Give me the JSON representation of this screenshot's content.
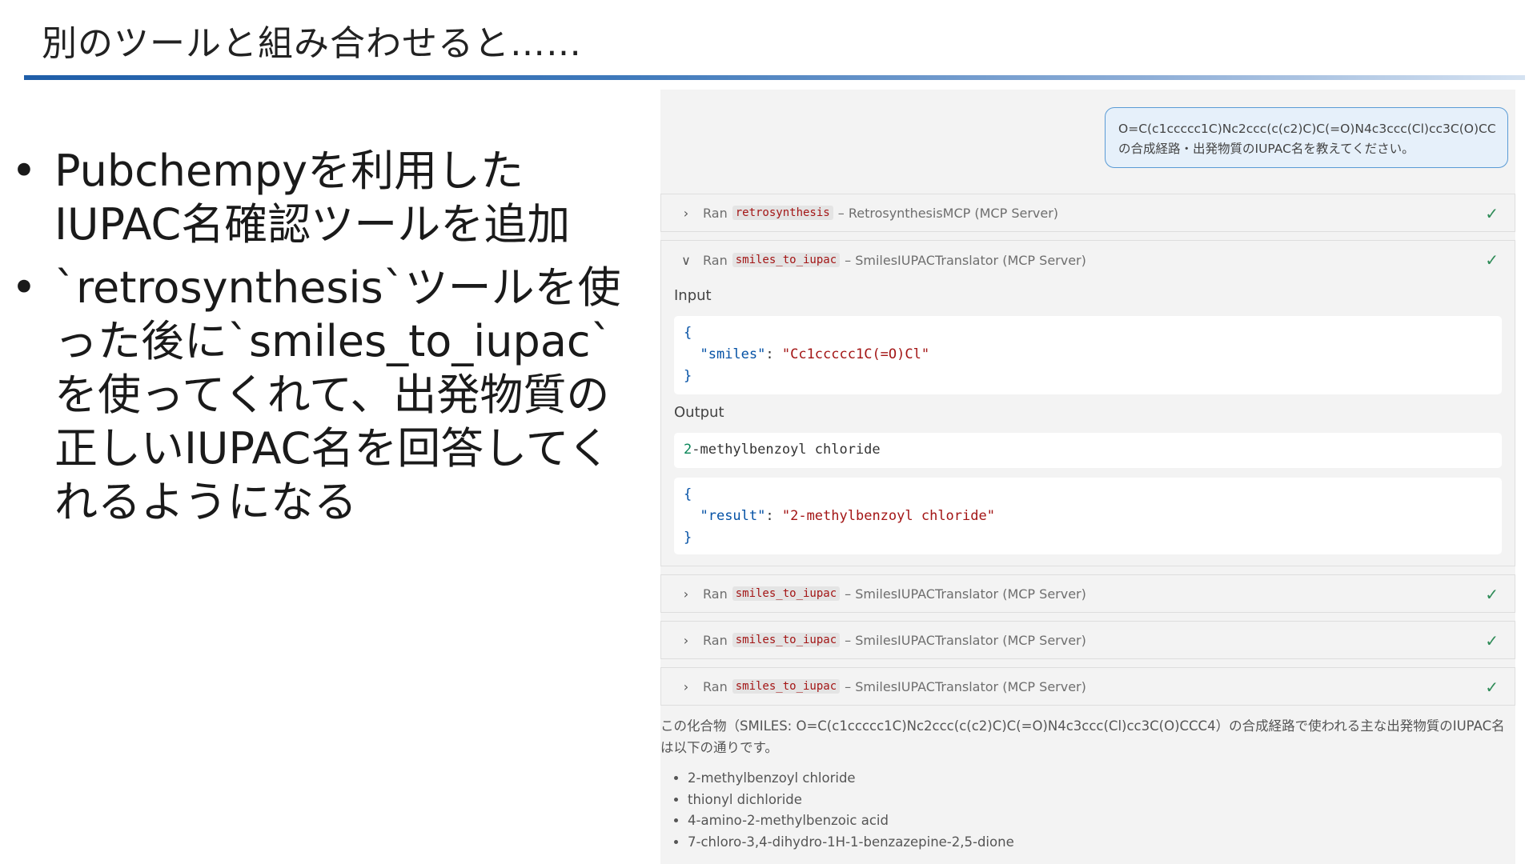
{
  "slide": {
    "title": "別のツールと組み合わせると……",
    "bullets": [
      "Pubchempyを利用したIUPAC名確認ツールを追加",
      "`retrosynthesis`ツールを使った後に`smiles_to_iupac`を使ってくれて、出発物質の正しいIUPAC名を回答してくれるようになる"
    ],
    "accent_color": "#1f5ea8"
  },
  "chat": {
    "user_prompt": {
      "line1": "O=C(c1ccccc1C)Nc2ccc(c(c2)C)C(=O)N4c3ccc(Cl)cc3C(O)CCC4",
      "line2": "の合成経路・出発物質のIUPAC名を教えてください。"
    },
    "tool_calls": [
      {
        "ran": "Ran",
        "tool": "retrosynthesis",
        "server": "– RetrosynthesisMCP (MCP Server)",
        "status_icon": "check-icon",
        "expanded": false
      },
      {
        "ran": "Ran",
        "tool": "smiles_to_iupac",
        "server": "– SmilesIUPACTranslator (MCP Server)",
        "status_icon": "check-icon",
        "expanded": true
      },
      {
        "ran": "Ran",
        "tool": "smiles_to_iupac",
        "server": "– SmilesIUPACTranslator (MCP Server)",
        "status_icon": "check-icon",
        "expanded": false
      },
      {
        "ran": "Ran",
        "tool": "smiles_to_iupac",
        "server": "– SmilesIUPACTranslator (MCP Server)",
        "status_icon": "check-icon",
        "expanded": false
      },
      {
        "ran": "Ran",
        "tool": "smiles_to_iupac",
        "server": "– SmilesIUPACTranslator (MCP Server)",
        "status_icon": "check-icon",
        "expanded": false
      }
    ],
    "expanded_detail": {
      "input_label": "Input",
      "input_json": {
        "open": "{",
        "key": "\"smiles\"",
        "colon": ": ",
        "value": "\"Cc1ccccc1C(=O)Cl\"",
        "close": "}"
      },
      "output_label": "Output",
      "output_text_num": "2",
      "output_text_rest": "-methylbenzoyl chloride",
      "output_json": {
        "open": "{",
        "key": "\"result\"",
        "colon": ": ",
        "value": "\"2-methylbenzoyl chloride\"",
        "close": "}"
      }
    },
    "answer": {
      "intro": "この化合物（SMILES: O=C(c1ccccc1C)Nc2ccc(c(c2)C)C(=O)N4c3ccc(Cl)cc3C(O)CCC4）の合成経路で使われる主な出発物質のIUPAC名は以下の通りです。",
      "items": [
        "2-methylbenzoyl chloride",
        "thionyl dichloride",
        "4-amino-2-methylbenzoic acid",
        "7-chloro-3,4-dihydro-1H-1-benzazepine-2,5-dione"
      ]
    },
    "colors": {
      "check": "#2e8b57",
      "tool_code": "#a31515",
      "json_key": "#0451a5",
      "bubble_border": "#5a9bd5"
    }
  }
}
